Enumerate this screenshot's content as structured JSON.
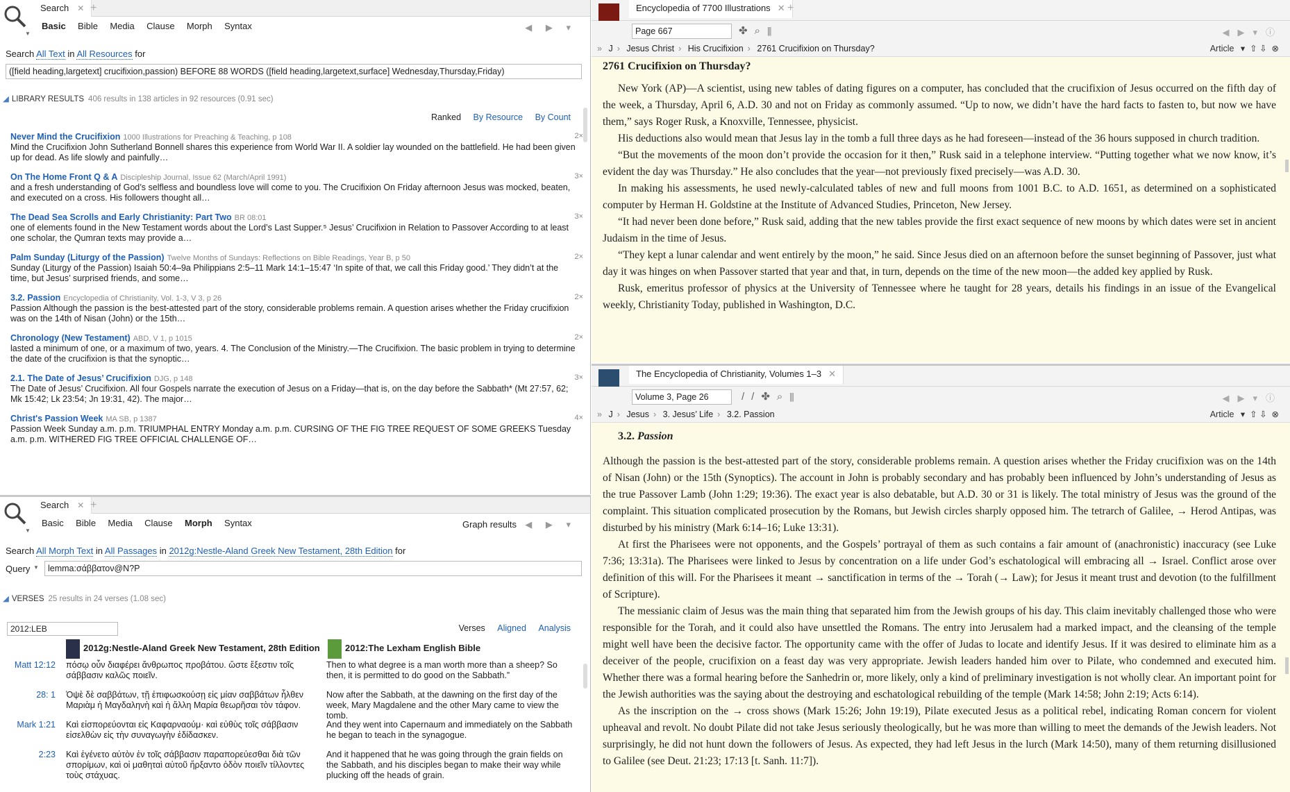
{
  "search_top": {
    "tab_label": "Search",
    "nav": [
      "Basic",
      "Bible",
      "Media",
      "Clause",
      "Morph",
      "Syntax"
    ],
    "active_nav": "Basic",
    "search_prefix": "Search",
    "scope_text": "All Text",
    "in_word": "in",
    "scope_resources": "All Resources",
    "for_word": "for",
    "query": "([field heading,largetext] crucifixion,passion) BEFORE 88 WORDS ([field heading,largetext,surface] Wednesday,Thursday,Friday)",
    "section_title": "LIBRARY RESULTS",
    "section_meta": "406 results in 138 articles in 92 resources (0.91 sec)",
    "sort": [
      "Ranked",
      "By Resource",
      "By Count"
    ],
    "results": [
      {
        "title": "Never Mind the Crucifixion",
        "source": "1000 Illustrations for Preaching & Teaching, p 108",
        "count": "2×",
        "snippet": "Mind the Crucifixion John Sutherland Bonnell shares this experience from World War II. A soldier lay wounded on the battlefield. He had been given up for dead. As life slowly and painfully…"
      },
      {
        "title": "On The Home Front Q & A",
        "source": "Discipleship Journal, Issue 62 (March/April 1991)",
        "count": "3×",
        "snippet": "and a fresh understanding of God’s selfless and boundless love will come to you. The Crucifixion On Friday afternoon Jesus was mocked, beaten, and executed on a cross. His followers thought all…"
      },
      {
        "title": "The Dead Sea Scrolls and Early Christianity: Part Two",
        "source": "BR 08:01",
        "count": "3×",
        "snippet": "one of elements found in the New Testament words about the Lord’s Last Supper.⁵ Jesus’ Crucifixion in Relation to Passover According to at least one scholar, the Qumran texts may provide a…"
      },
      {
        "title": "Palm Sunday (Liturgy of the Passion)",
        "source": "Twelve Months of Sundays: Reflections on Bible Readings, Year B, p 50",
        "count": "2×",
        "snippet": "Sunday (Liturgy of the Passion) Isaiah 50:4–9a Philippians 2:5–11 Mark 14:1–15:47 ‘In spite of that, we call this Friday good.’ They didn’t at the time, but Jesus’ surprised friends, and some…"
      },
      {
        "title": "3.2. Passion",
        "source": "Encyclopedia of Christianity, Vol. 1-3, V 3, p 26",
        "count": "2×",
        "snippet": "Passion Although the passion is the best-attested part of the story, considerable problems remain. A question arises whether the Friday crucifixion was on the 14th of Nisan (John) or the 15th…"
      },
      {
        "title": "Chronology (New Testament)",
        "source": "ABD, V 1, p 1015",
        "count": "2×",
        "snippet": "lasted a minimum of one, or a maximum of two, years. 4. The Conclusion of the Ministry.—The Crucifixion. The basic problem in trying to determine the date of the crucifixion is that the synoptic…"
      },
      {
        "title": "2.1. The Date of Jesus’ Crucifixion",
        "source": "DJG, p 148",
        "count": "3×",
        "snippet": "The Date of Jesus’ Crucifixion. All four Gospels narrate the execution of Jesus on a Friday—that is, on the day before the Sabbath* (Mt 27:57, 62; Mk 15:42; Lk 23:54; Jn 19:31, 42). The major…"
      },
      {
        "title": "Christ's Passion Week",
        "source": "MA SB, p 1387",
        "count": "4×",
        "snippet": "Passion Week Sunday a.m. p.m. TRIUMPHAL ENTRY Monday a.m. p.m. CURSING OF THE FIG TREE REQUEST OF SOME GREEKS Tuesday a.m. p.m. WITHERED FIG TREE OFFICIAL CHALLENGE OF…"
      }
    ]
  },
  "search_bottom": {
    "tab_label": "Search",
    "nav": [
      "Basic",
      "Bible",
      "Media",
      "Clause",
      "Morph",
      "Syntax"
    ],
    "active_nav": "Morph",
    "graph_label": "Graph results",
    "search_prefix": "Search",
    "scope_text": "All Morph Text",
    "in_word": "in",
    "scope_passages": "All Passages",
    "in_word2": "in",
    "scope_resource": "2012g:Nestle-Aland Greek New Testament, 28th Edition",
    "for_word": "for",
    "query_label": "Query",
    "query": "lemma:σάββατον@N?P",
    "section_title": "VERSES",
    "section_meta": "25 results in 24 verses (1.08 sec)",
    "version_box": "2012:LEB",
    "views": [
      "Verses",
      "Aligned",
      "Analysis"
    ],
    "col_greek": "2012g:Nestle-Aland Greek New Testament, 28th Edition",
    "col_english": "2012:The Lexham English Bible",
    "verses": [
      {
        "ref": "Matt  12:12",
        "greek": "πόσῳ οὖν διαφέρει ἄνθρωπος προβάτου. ὥστε ἔξεστιν τοῖς σάββασιν καλῶς ποιεῖν.",
        "english": "Then to what degree is a man worth more than a sheep? So then, it is permitted to do good on the Sabbath.”"
      },
      {
        "ref": "28: 1",
        "greek": "Ὀψὲ δὲ σαββάτων, τῇ ἐπιφωσκούσῃ εἰς μίαν σαββάτων ἦλθεν Μαριὰμ ἡ Μαγδαληνὴ καὶ ἡ ἄλλη Μαρία θεωρῆσαι τὸν τάφον.",
        "english": "Now after the Sabbath, at the dawning on the first day of the week, Mary Magdalene and the other Mary came to view the tomb."
      },
      {
        "ref": "Mark  1:21",
        "greek": "Καὶ εἰσπορεύονται εἰς Καφαρναούμ· καὶ εὐθὺς τοῖς σάββασιν εἰσελθὼν εἰς τὴν συναγωγὴν ἐδίδασκεν.",
        "english": "And they went into Capernaum and immediately on the Sabbath he began to teach in the synagogue."
      },
      {
        "ref": "2:23",
        "greek": "Καὶ ἐγένετο αὐτὸν ἐν τοῖς σάββασιν παραπορεύεσθαι διὰ τῶν σπορίμων, καὶ οἱ μαθηταὶ αὐτοῦ ἤρξαντο ὁδὸν ποιεῖν τίλλοντες τοὺς στάχυας.",
        "english": "And it happened that he was going through the grain fields on the Sabbath, and his disciples began to make their way while plucking off the heads of grain."
      }
    ]
  },
  "enc_top": {
    "tab_label": "Encyclopedia of 7700 Illustrations",
    "page_box": "Page 667",
    "crumb": [
      "J",
      "Jesus Christ",
      "His Crucifixion",
      "2761 Crucifixion on Thursday?"
    ],
    "view_label": "Article",
    "heading": "2761 Crucifixion on Thursday?",
    "paragraphs": [
      "New York (AP)—A scientist, using new tables of dating figures on a computer, has concluded that the crucifixion of Jesus occurred on the fifth day of the week, a Thursday, April 6, A.D. 30 and not on Friday as commonly assumed. “Up to now, we didn’t have the hard facts to fasten to, but now we have them,” says Roger Rusk, a Knoxville, Tennessee, physicist.",
      "His deductions also would mean that Jesus lay in the tomb a full three days as he had foreseen—instead of the 36 hours supposed in church tradition.",
      "“But the movements of the moon don’t provide the occasion for it then,” Rusk said in a telephone interview. “Putting together what we now know, it’s evident the day was Thursday.” He also concludes that the year—not previously fixed precisely—was A.D. 30.",
      "In making his assessments, he used newly-calculated tables of new and full moons from 1001 B.C. to A.D. 1651, as determined on a sophisticated computer by Herman H. Goldstine at the Institute of Advanced Studies, Princeton, New Jersey.",
      "“It had never been done before,” Rusk said, adding that the new tables provide the first exact sequence of new moons by which dates were set in ancient Judaism in the time of Jesus.",
      "“They kept a lunar calendar and went entirely by the moon,” he said. Since Jesus died on an afternoon before the sunset beginning of Passover, just what day it was hinges on when Passover started that year and that, in turn, depends on the time of the new moon—the added key applied by Rusk.",
      "Rusk, emeritus professor of physics at the University of Tennessee where he taught for 28 years, details his findings in an issue of the Evangelical weekly, Christianity Today, published in Washington, D.C."
    ]
  },
  "enc_bot": {
    "tab_label": "The Encyclopedia of Christianity, Volumes 1–3",
    "page_box": "Volume 3, Page 26",
    "crumb": [
      "J",
      "Jesus",
      "3. Jesus’ Life",
      "3.2. Passion"
    ],
    "view_label": "Article",
    "heading_num": "3.2.",
    "heading": "Passion",
    "paragraphs": [
      "Although the passion is the best-attested part of the story, considerable problems remain. A question arises whether the Friday crucifixion was on the 14th of Nisan (John) or the 15th (Synoptics). The account in John is probably secondary and has probably been influenced by John’s understanding of Jesus as the true Passover Lamb (John 1:29; 19:36). The exact year is also debatable, but A.D. 30 or 31 is likely. The total ministry of Jesus was the ground of the complaint. This situation complicated prosecution by the Romans, but Jewish circles sharply opposed him. The tetrarch of Galilee, → Herod Antipas, was disturbed by his ministry (Mark 6:14–16; Luke 13:31).",
      "At first the Pharisees were not opponents, and the Gospels’ portrayal of them as such contains a fair amount of (anachronistic) inaccuracy (see Luke 7:36; 13:31a). The Pharisees were linked to Jesus by concentration on a life under God’s eschatological will embracing all → Israel. Conflict arose over definition of this will. For the Pharisees it meant → sanctification in terms of the → Torah (→ Law); for Jesus it meant trust and devotion (to the fulfillment of Scripture).",
      "The messianic claim of Jesus was the main thing that separated him from the Jewish groups of his day. This claim inevitably challenged those who were responsible for the Torah, and it could also have unsettled the Romans. The entry into Jerusalem had a marked impact, and the cleansing of the temple might well have been the decisive factor. The opportunity came with the offer of Judas to locate and identify Jesus. If it was desired to eliminate him as a deceiver of the people, crucifixion on a feast day was very appropriate. Jewish leaders handed him over to Pilate, who condemned and executed him. Whether there was a formal hearing before the Sanhedrin or, more likely, only a kind of preliminary investigation is not wholly clear. An important point for the Jewish authorities was the saying about the destroying and eschatological rebuilding of the temple (Mark 14:58; John 2:19; Acts 6:14).",
      "As the inscription on the → cross shows (Mark 15:26; John 19:19), Pilate executed Jesus as a political rebel, indicating Roman concern for violent upheaval and revolt. No doubt Pilate did not take Jesus seriously theologically, but he was more than willing to meet the demands of the Jewish leaders. Not surprisingly, he did not hunt down the followers of Jesus. As expected, they had left Jesus in the lurch (Mark 14:50), many of them returning disillusioned to Galilee (see Deut. 21:23; 17:13 [t. Sanh. 11:7])."
    ]
  },
  "colors": {
    "accent_link": "#1f5fb5",
    "highlight_yellow": "#fbe8a6",
    "highlight_blue": "#dde8f5",
    "reader_bg": "#fdfbe6"
  }
}
